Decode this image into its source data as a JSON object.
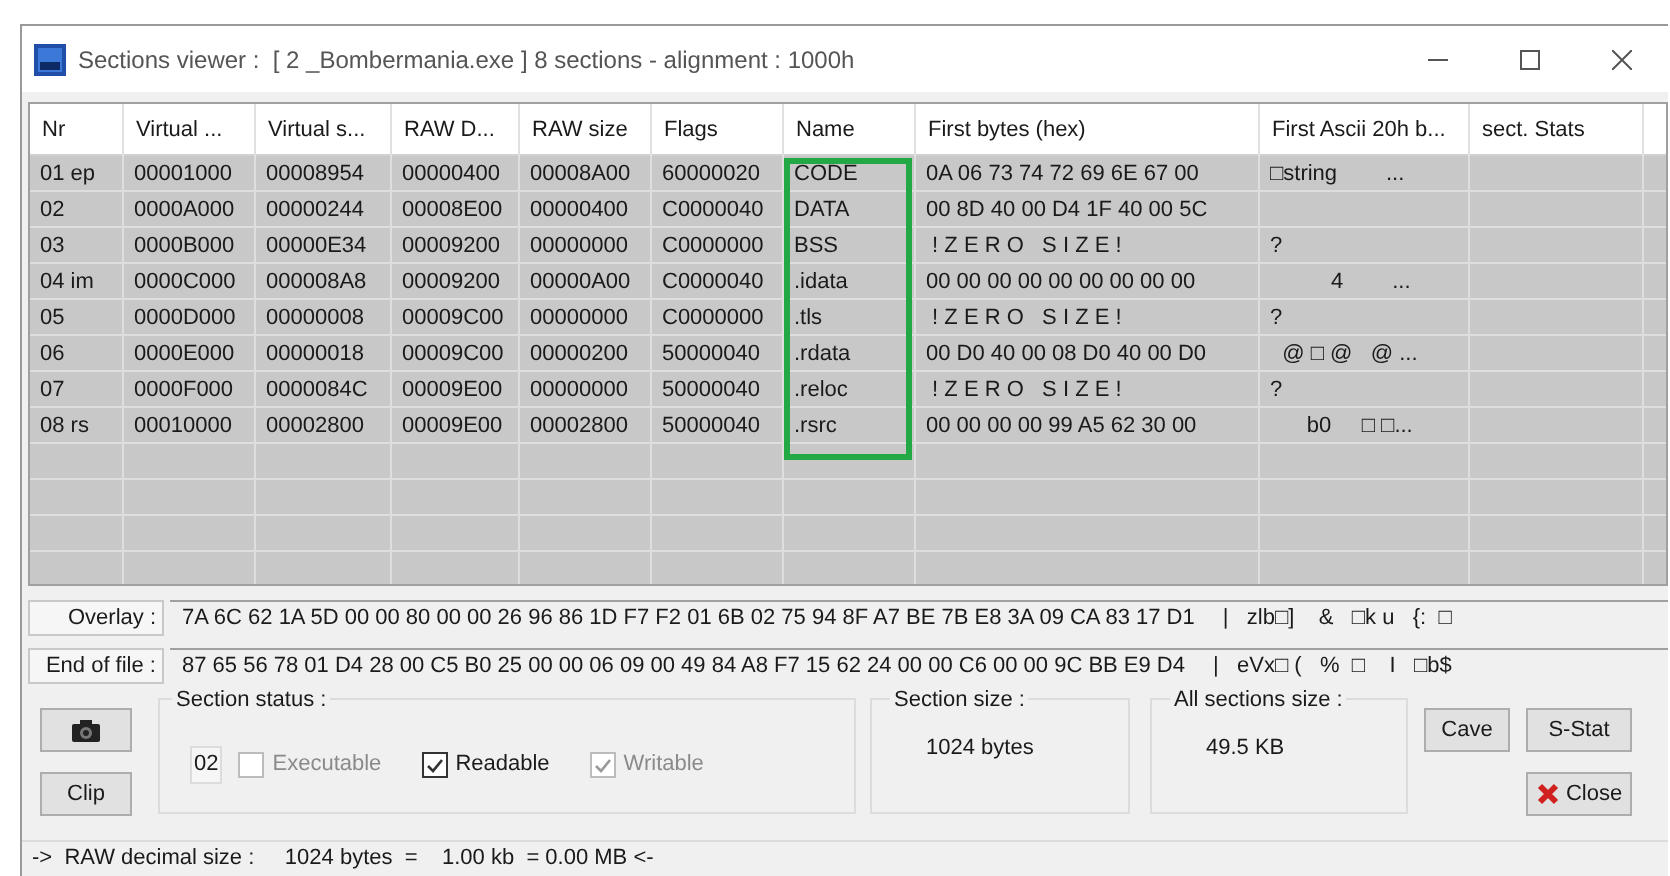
{
  "window": {
    "title": "Sections viewer :  [ 2 _Bombermania.exe ] 8 sections - alignment : 1000h"
  },
  "table": {
    "columns": [
      "Nr",
      "Virtual ...",
      "Virtual s...",
      "RAW D...",
      "RAW size",
      "Flags",
      "Name",
      "First bytes (hex)",
      "First Ascii 20h b...",
      "sect. Stats"
    ],
    "rows": [
      {
        "cells": [
          "01 ep",
          "00001000",
          "00008954",
          "00000400",
          "00008A00",
          "60000020",
          "CODE",
          "0A 06 73 74 72 69 6E 67 00",
          "□string        ...",
          ""
        ]
      },
      {
        "cells": [
          "02",
          "0000A000",
          "00000244",
          "00008E00",
          "00000400",
          "C0000040",
          "DATA",
          "00 8D 40 00 D4 1F 40 00 5C",
          "",
          ""
        ]
      },
      {
        "cells": [
          "03",
          "0000B000",
          "00000E34",
          "00009200",
          "00000000",
          "C0000000",
          "BSS",
          " ! Z E R O   S I Z E !",
          "?",
          ""
        ]
      },
      {
        "cells": [
          "04 im",
          "0000C000",
          "000008A8",
          "00009200",
          "00000A00",
          "C0000040",
          ".idata",
          "00 00 00 00 00 00 00 00 00",
          "          4        ...",
          ""
        ]
      },
      {
        "cells": [
          "05",
          "0000D000",
          "00000008",
          "00009C00",
          "00000000",
          "C0000000",
          ".tls",
          " ! Z E R O   S I Z E !",
          "?",
          ""
        ]
      },
      {
        "cells": [
          "06",
          "0000E000",
          "00000018",
          "00009C00",
          "00000200",
          "50000040",
          ".rdata",
          "00 D0 40 00 08 D0 40 00 D0",
          "  @ □ @   @ ...",
          ""
        ]
      },
      {
        "cells": [
          "07",
          "0000F000",
          "0000084C",
          "00009E00",
          "00000000",
          "50000040",
          ".reloc",
          " ! Z E R O   S I Z E !",
          "?",
          ""
        ]
      },
      {
        "cells": [
          "08 rs",
          "00010000",
          "00002800",
          "00009E00",
          "00002800",
          "50000040",
          ".rsrc",
          "00 00 00 00 99 A5 62 30 00",
          "      b0     □ □...",
          ""
        ]
      }
    ]
  },
  "overlay": {
    "label": "Overlay :",
    "hex": "7A 6C 62 1A 5D 00 00 80 00 00 26 96 86 1D F7 F2 01 6B 02 75 94 8F A7 BE 7B E8 3A 09 CA 83 17 D1",
    "ascii": "|   zlb□]    &   □k u   {:  □"
  },
  "end_of_file": {
    "label": "End of file :",
    "hex": "87 65 56 78 01 D4 28 00 C5 B0 25 00 00 06 09 00 49 84 A8 F7 15 62 24 00 00 C6 00 00 9C BB E9 D4",
    "ascii": "|   eVx□ (   %  □    I   □b$"
  },
  "section_status": {
    "title": "Section status :",
    "number": "02",
    "flags": [
      {
        "label": "Executable",
        "checked": false,
        "disabled": true
      },
      {
        "label": "Readable",
        "checked": true,
        "disabled": false
      },
      {
        "label": "Writable",
        "checked": true,
        "disabled": true
      }
    ]
  },
  "section_size": {
    "title": "Section size :",
    "value": "1024 bytes"
  },
  "all_sections_size": {
    "title": "All sections size :",
    "value": "49.5 KB"
  },
  "buttons": {
    "clip": "Clip",
    "cave": "Cave",
    "sstat": "S-Stat",
    "close": "Close"
  },
  "status_bar": "->  RAW decimal size :     1024 bytes  =    1.00 kb  = 0.00 MB <-"
}
